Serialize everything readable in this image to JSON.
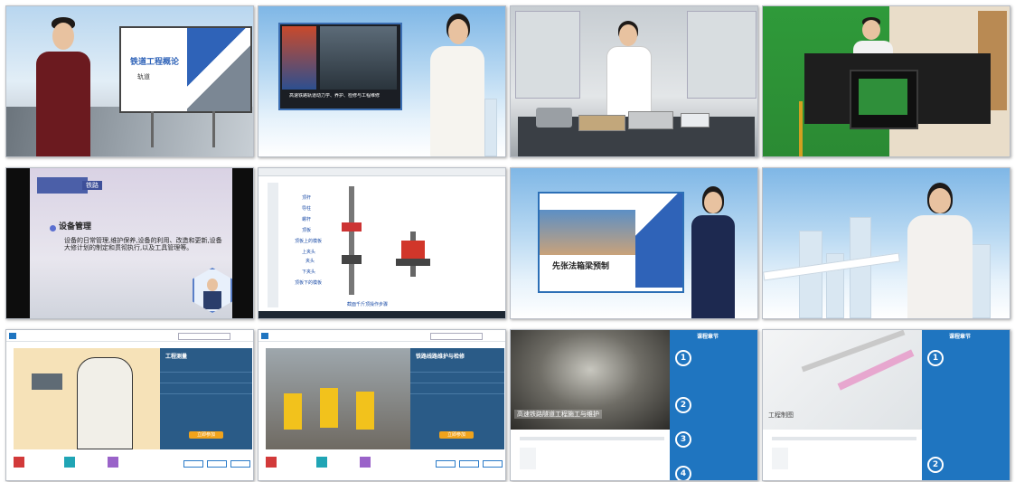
{
  "tiles": {
    "t1": {
      "slide_title": "铁道工程概论",
      "slide_subtitle": "轨道"
    },
    "t2": {
      "video_caption": "高速铁路轨道动力学、养护、检修与工程维修"
    },
    "t3": {},
    "t4": {},
    "t5": {
      "header": "铁路",
      "heading": "设备管理",
      "body": "设备的日常管理,维护保养,设备的利用、改造和更新,设备大修计划的制定和贯彻执行,以及工具管理等。"
    },
    "t6": {
      "labels": [
        "顶杆",
        "导柱",
        "螺杆",
        "顶板",
        "顶板上的模板",
        "上夹头",
        "夹头",
        "下夹头",
        "顶板下的模板"
      ],
      "caption": "截面千斤顶操作步骤"
    },
    "t7": {
      "slide_title": "先张法箱梁预制"
    },
    "t8": {},
    "t9": {
      "panel_title": "工程测量",
      "enroll_button": "立即参加"
    },
    "t10": {
      "panel_title": "铁路线路维护与检修",
      "enroll_button": "立即参加"
    },
    "t11": {
      "course_title": "高速铁路隧道工程施工与维护",
      "sidebar_title": "课程章节",
      "chapters": [
        "1",
        "2",
        "3",
        "4"
      ]
    },
    "t12": {
      "course_title": "工程制图",
      "sidebar_title": "课程章节",
      "chapters": [
        "1",
        "2"
      ]
    }
  },
  "colors": {
    "accent": "#1f75c0",
    "navy": "#1f3a8a",
    "slide_blue": "#2f63b8"
  }
}
